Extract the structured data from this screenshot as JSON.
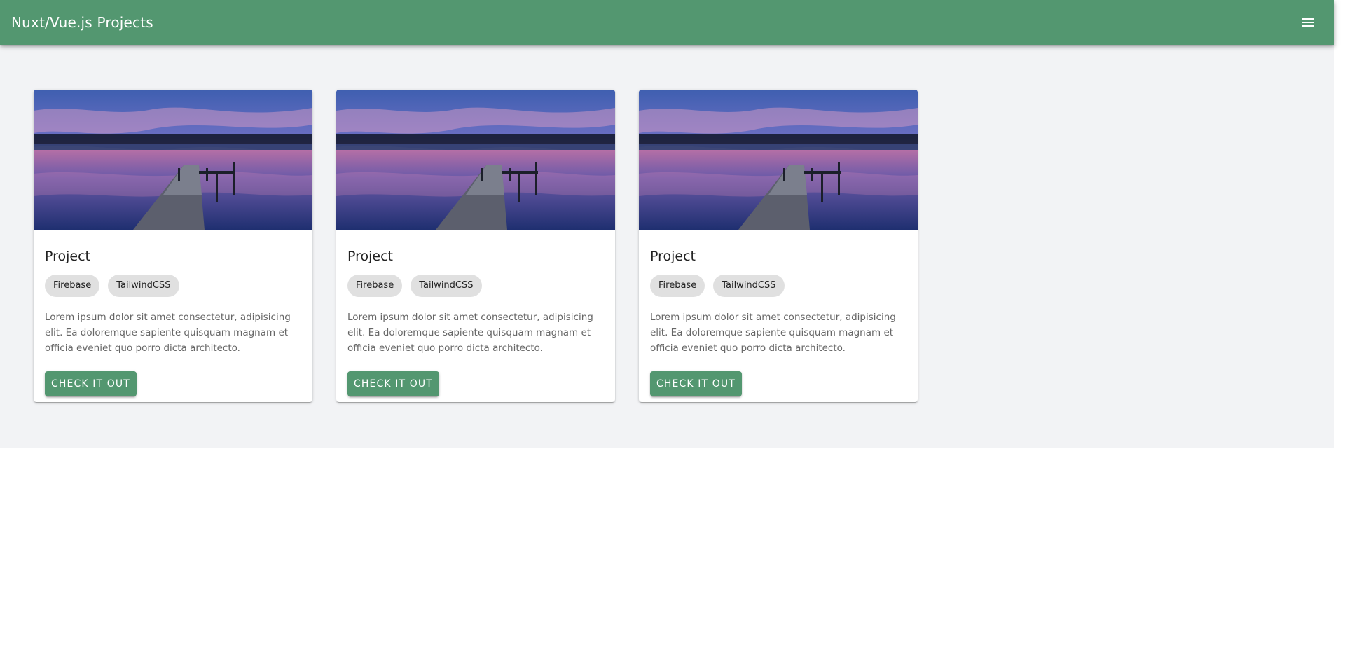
{
  "app": {
    "title": "Nuxt/Vue.js Projects",
    "menu_icon": "hamburger-menu-icon"
  },
  "colors": {
    "primary": "#539770",
    "background": "#f2f3f5",
    "chip": "#e0e0e0"
  },
  "cards": [
    {
      "title": "Project",
      "image": "sunset-dock-lake-photo",
      "tags": [
        "Firebase",
        "TailwindCSS"
      ],
      "description": "Lorem ipsum dolor sit amet consectetur, adipisicing elit. Ea doloremque sapiente quisquam magnam et officia eveniet quo porro dicta architecto.",
      "button": "CHECK IT OUT"
    },
    {
      "title": "Project",
      "image": "sunset-dock-lake-photo",
      "tags": [
        "Firebase",
        "TailwindCSS"
      ],
      "description": "Lorem ipsum dolor sit amet consectetur, adipisicing elit. Ea doloremque sapiente quisquam magnam et officia eveniet quo porro dicta architecto.",
      "button": "CHECK IT OUT"
    },
    {
      "title": "Project",
      "image": "sunset-dock-lake-photo",
      "tags": [
        "Firebase",
        "TailwindCSS"
      ],
      "description": "Lorem ipsum dolor sit amet consectetur, adipisicing elit. Ea doloremque sapiente quisquam magnam et officia eveniet quo porro dicta architecto.",
      "button": "CHECK IT OUT"
    }
  ]
}
